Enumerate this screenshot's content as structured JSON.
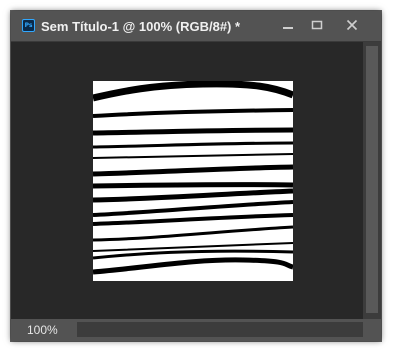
{
  "window": {
    "app_icon": "photoshop-app-icon",
    "app_icon_text": "Ps",
    "title": "Sem Título-1 @ 100% (RGB/8#) *",
    "controls": {
      "minimize_icon": "minimize-icon",
      "restore_icon": "restore-icon",
      "close_icon": "close-icon"
    }
  },
  "document": {
    "content": "black-and-white horizontal wavy stripes",
    "colors": {
      "background": "#ffffff",
      "stripes": "#000000"
    }
  },
  "status_bar": {
    "zoom": "100%"
  },
  "colors": {
    "titlebar": "#535353",
    "workspace": "#282828",
    "title_text": "#f0f0f0"
  }
}
